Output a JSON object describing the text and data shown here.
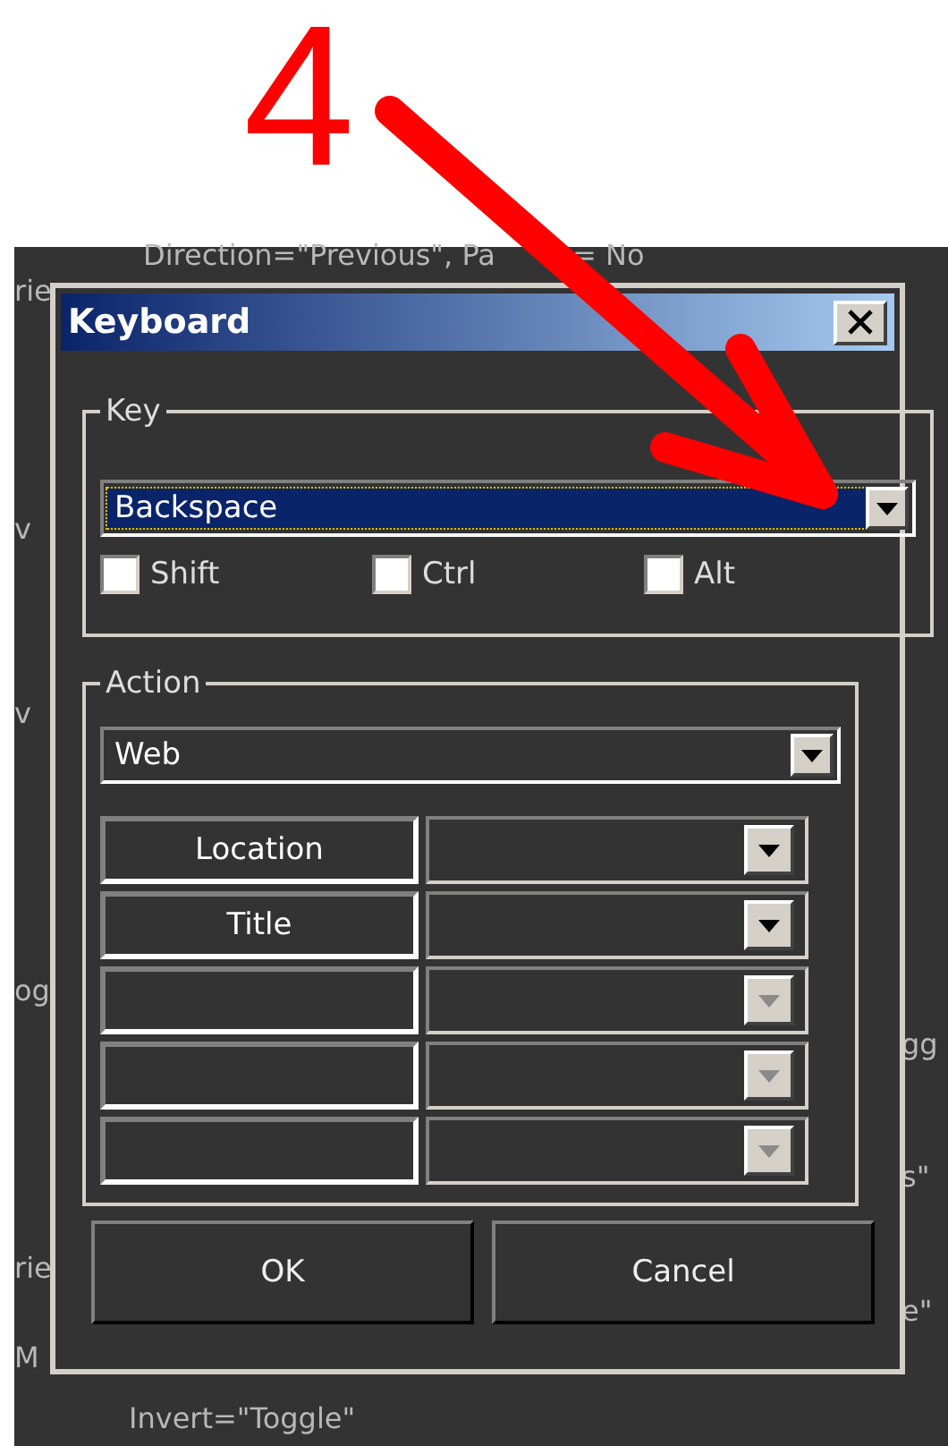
{
  "annotation": {
    "label": "4"
  },
  "background_text": {
    "top": [
      "Direction=\"Previous\", Pa",
      "= No"
    ],
    "left": [
      "rie",
      "v",
      "v",
      "og",
      "rie",
      "M"
    ],
    "right": [
      "gg",
      "s\"",
      "e\""
    ],
    "bottom": [
      "Invert=\"Toggle\""
    ]
  },
  "dialog": {
    "title": "Keyboard",
    "key_group": {
      "label": "Key",
      "key": {
        "value": "Backspace",
        "focused": true
      },
      "modifiers": [
        {
          "label": "Shift",
          "checked": false
        },
        {
          "label": "Ctrl",
          "checked": false
        },
        {
          "label": "Alt",
          "checked": false
        }
      ]
    },
    "action_group": {
      "label": "Action",
      "action": {
        "value": "Web"
      },
      "parameters": [
        {
          "label": "Location",
          "disabled": false
        },
        {
          "label": "Title",
          "disabled": false
        },
        {
          "disabled": true
        },
        {
          "disabled": true
        },
        {
          "disabled": true
        }
      ]
    },
    "buttons": [
      "OK",
      "Cancel"
    ]
  }
}
